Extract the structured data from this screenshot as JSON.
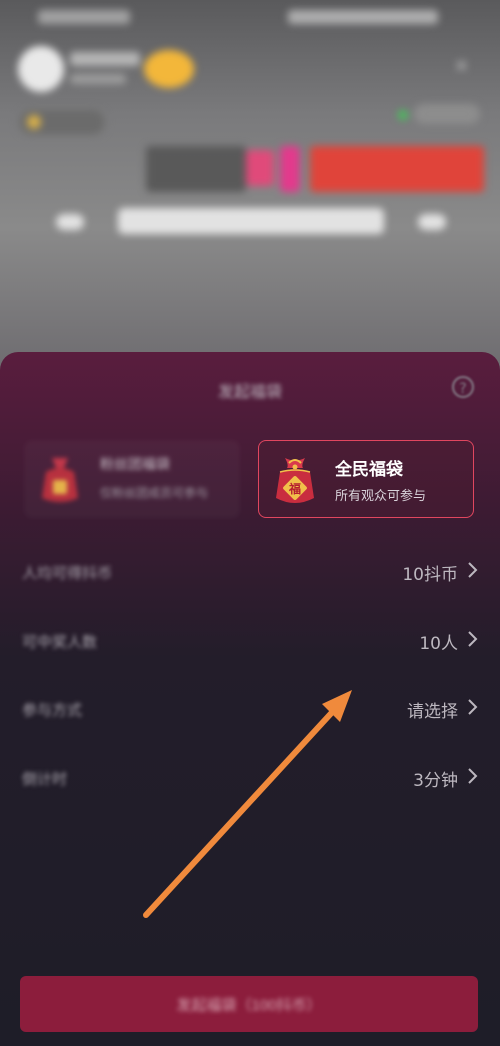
{
  "sheet": {
    "title": "发起福袋",
    "help_icon": "question-circle-icon"
  },
  "bag_types": [
    {
      "title": "粉丝团福袋",
      "subtitle": "仅粉丝团成员可参与",
      "selected": false
    },
    {
      "title": "全民福袋",
      "subtitle": "所有观众可参与",
      "selected": true
    }
  ],
  "settings": [
    {
      "label": "人均可得抖币",
      "value": "10抖币"
    },
    {
      "label": "可中奖人数",
      "value": "10人"
    },
    {
      "label": "参与方式",
      "value": "请选择"
    },
    {
      "label": "倒计时",
      "value": "3分钟"
    }
  ],
  "submit": {
    "label": "发起福袋（100抖币）"
  },
  "colors": {
    "accent": "#e0465f",
    "annotation_arrow": "#f08a3c",
    "submit_bg": "#8c1d3c"
  }
}
